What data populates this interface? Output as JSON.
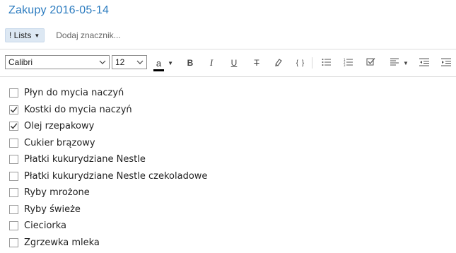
{
  "note": {
    "title": "Zakupy 2016-05-14"
  },
  "tags": {
    "active_tag": "! Lists",
    "add_placeholder": "Dodaj znacznik..."
  },
  "toolbar": {
    "font_family": "Calibri",
    "font_size": "12",
    "font_color_label": "a",
    "font_color": "#000000",
    "bold_label": "B",
    "italic_label": "I",
    "underline_label": "U",
    "strikethrough_label": "T",
    "code_label": "{ }"
  },
  "checklist": [
    {
      "text": "Płyn do mycia naczyń",
      "checked": false
    },
    {
      "text": "Kostki do mycia naczyń",
      "checked": true
    },
    {
      "text": "Olej rzepakowy",
      "checked": true
    },
    {
      "text": "Cukier brązowy",
      "checked": false
    },
    {
      "text": "Płatki kukurydziane Nestle",
      "checked": false
    },
    {
      "text": "Płatki kukurydziane Nestle czekoladowe",
      "checked": false
    },
    {
      "text": "Ryby mrożone",
      "checked": false
    },
    {
      "text": "Ryby świeże",
      "checked": false
    },
    {
      "text": "Cieciorka",
      "checked": false
    },
    {
      "text": "Zgrzewka mleka",
      "checked": false
    }
  ],
  "colors": {
    "title": "#2b7bbf",
    "tag_bg": "#dde8f3"
  }
}
